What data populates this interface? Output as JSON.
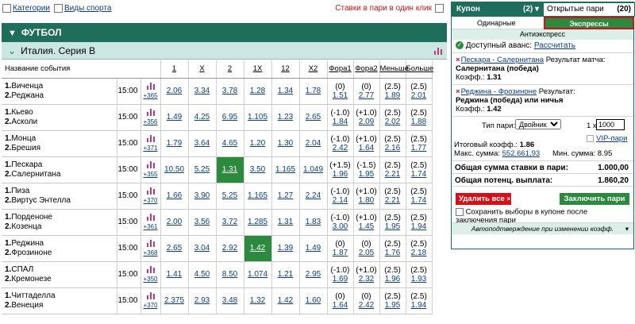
{
  "filters": {
    "categories": "Категории",
    "sport_types": "Виды спорта",
    "one_click": "Ставки в пари в один клик"
  },
  "sport": "ФУТБОЛ",
  "league": "Италия. Серия B",
  "columns": [
    "Название события",
    "1",
    "X",
    "2",
    "1X",
    "12",
    "X2",
    "Фора1",
    "Фора2",
    "Меньше",
    "Больше"
  ],
  "events": [
    {
      "t1": "Виченца",
      "t2": "Реджана",
      "time": "15:00",
      "more": "+365",
      "o": [
        "2.06",
        "3.34",
        "3.78",
        "1.28",
        "1.34",
        "1.78"
      ],
      "f1h": "(0)",
      "f1": "1.51",
      "f2h": "(0)",
      "f2": "2.77",
      "uh": "(2.5)",
      "u": "1.89",
      "oh": "(2.5)",
      "ov": "2.01"
    },
    {
      "t1": "Кьево",
      "t2": "Асколи",
      "time": "15:00",
      "more": "+356",
      "o": [
        "1.49",
        "4.25",
        "6.95",
        "1.105",
        "1.23",
        "2.65"
      ],
      "f1h": "(-1.0)",
      "f1": "1.84",
      "f2h": "(+1.0)",
      "f2": "2.09",
      "uh": "(2.5)",
      "u": "2.02",
      "oh": "(2.5)",
      "ov": "1.88"
    },
    {
      "t1": "Монца",
      "t2": "Брешия",
      "time": "15:00",
      "more": "+371",
      "o": [
        "1.79",
        "3.64",
        "4.65",
        "1.20",
        "1.30",
        "2.04"
      ],
      "f1h": "(-1.0)",
      "f1": "2.42",
      "f2h": "(+1.0)",
      "f2": "1.64",
      "uh": "(2.5)",
      "u": "2.16",
      "oh": "(2.5)",
      "ov": "1.77"
    },
    {
      "t1": "Пескара",
      "t2": "Салернитана",
      "time": "15:00",
      "more": "+355",
      "o": [
        "10.50",
        "5.25",
        "1.31",
        "3.50",
        "1.165",
        "1.049"
      ],
      "f1h": "(+1.5)",
      "f1": "1.96",
      "f2h": "(-1.5)",
      "f2": "1.95",
      "uh": "(2.5)",
      "u": "2.21",
      "oh": "(2.5)",
      "ov": "1.74",
      "sel": 2
    },
    {
      "t1": "Пиза",
      "t2": "Виртус Энтелла",
      "time": "15:00",
      "more": "+370",
      "o": [
        "1.66",
        "3.90",
        "5.25",
        "1.165",
        "1.27",
        "2.24"
      ],
      "f1h": "(-1.0)",
      "f1": "2.14",
      "f2h": "(+1.0)",
      "f2": "1.80",
      "uh": "(2.5)",
      "u": "2.21",
      "oh": "(2.5)",
      "ov": "1.74"
    },
    {
      "t1": "Порденоне",
      "t2": "Козенца",
      "time": "15:00",
      "more": "+361",
      "o": [
        "2.00",
        "3.56",
        "3.72",
        "1.285",
        "1.31",
        "1.83"
      ],
      "f1h": "(-1.0)",
      "f1": "3.00",
      "f2h": "(+1.0)",
      "f2": "1.45",
      "uh": "(2.5)",
      "u": "1.95",
      "oh": "(2.5)",
      "ov": "1.94"
    },
    {
      "t1": "Реджина",
      "t2": "Фрозиноне",
      "time": "15:00",
      "more": "+368",
      "o": [
        "2.65",
        "3.04",
        "2.92",
        "1.42",
        "1.39",
        "1.49"
      ],
      "f1h": "(0)",
      "f1": "1.87",
      "f2h": "(0)",
      "f2": "2.05",
      "uh": "(2.5)",
      "u": "1.76",
      "oh": "(2.5)",
      "ov": "2.18",
      "sel": 3
    },
    {
      "t1": "СПАЛ",
      "t2": "Кремонезе",
      "time": "15:00",
      "more": "+350",
      "o": [
        "1.41",
        "4.50",
        "8.50",
        "1.074",
        "1.21",
        "2.95"
      ],
      "f1h": "(-1.0)",
      "f1": "1.69",
      "f2h": "(+1.0)",
      "f2": "2.32",
      "uh": "(2.5)",
      "u": "1.96",
      "oh": "(2.5)",
      "ov": "1.93"
    },
    {
      "t1": "Читтаделла",
      "t2": "Венеция",
      "time": "15:00",
      "more": "+370",
      "o": [
        "2.375",
        "2.93",
        "3.48",
        "1.32",
        "1.42",
        "1.60"
      ],
      "f1h": "(0)",
      "f1": "1.64",
      "f2h": "(0)",
      "f2": "2.42",
      "uh": "(2.5)",
      "u": "1.95",
      "oh": "(2.5)",
      "ov": "1.94"
    }
  ],
  "coupon": {
    "tab_coupon": "Купон",
    "tab_coupon_count": "(2)",
    "tab_open": "Открытые пари",
    "tab_open_count": "(20)",
    "single": "Одинарные",
    "express": "Экспрессы",
    "anti": "Антиэкспресс",
    "avans_label": "Доступный аванс:",
    "avans_link": "Рассчитать",
    "bets": [
      {
        "match": "Пескара - Салернитана",
        "market": "Результат матча:",
        "pick": "Салернитана (победа)",
        "coef_label": "Коэфф.:",
        "coef": "1.31"
      },
      {
        "match": "Реджина - Фрозиноне",
        "market": "Результат:",
        "pick": "Реджина (победа) или ничья",
        "coef_label": "Коэфф.:",
        "coef": "1.42"
      }
    ],
    "type_label": "Тип пари:",
    "type_value": "Двойник",
    "mult": "1 x",
    "stake": "1000",
    "vip": "VIP-пари",
    "total_coef_label": "Итоговый коэфф.:",
    "total_coef": "1.86",
    "max_label": "Макс. сумма:",
    "max_value": "552.661,93",
    "min_label": "Мин. сумма:",
    "min_value": "8.95",
    "stake_label": "Общая сумма ставки в пари:",
    "stake_value": "1.000,00",
    "payout_label": "Общая потенц. выплата:",
    "payout_value": "1.860,20",
    "delete_all": "Удалить все",
    "place": "Заключить пари",
    "keep": "Сохранить выборы в купоне после заключения пари",
    "auto": "Автоподтверждение при изменении коэфф."
  }
}
